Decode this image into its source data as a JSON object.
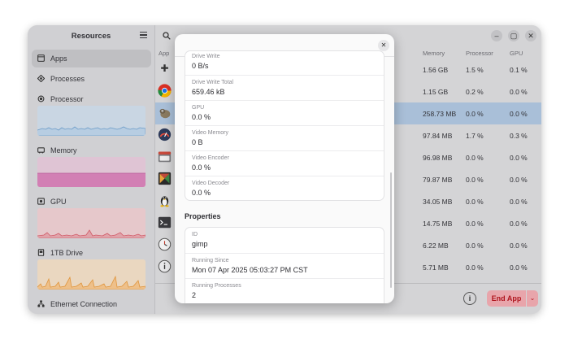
{
  "sidebar": {
    "title": "Resources",
    "items": [
      {
        "label": "Apps",
        "icon": "apps-icon"
      },
      {
        "label": "Processes",
        "icon": "processes-icon"
      },
      {
        "label": "Processor",
        "icon": "processor-icon"
      },
      {
        "label": "Memory",
        "icon": "memory-icon"
      },
      {
        "label": "GPU",
        "icon": "gpu-icon"
      },
      {
        "label": "1TB Drive",
        "icon": "drive-icon"
      },
      {
        "label": "Ethernet Connection",
        "icon": "network-icon"
      }
    ]
  },
  "table": {
    "columns": {
      "app": "App",
      "memory": "Memory",
      "processor": "Processor",
      "gpu": "GPU"
    },
    "rows": [
      {
        "icon": "puzzle-icon",
        "memory": "1.56 GB",
        "processor": "1.5 %",
        "gpu": "0.1 %"
      },
      {
        "icon": "chrome-icon",
        "memory": "1.15 GB",
        "processor": "0.2 %",
        "gpu": "0.0 %"
      },
      {
        "icon": "gimp-icon",
        "memory": "258.73 MB",
        "processor": "0.0 %",
        "gpu": "0.0 %"
      },
      {
        "icon": "gauge-icon",
        "memory": "97.84 MB",
        "processor": "1.7 %",
        "gpu": "0.3 %"
      },
      {
        "icon": "files-icon",
        "memory": "96.98 MB",
        "processor": "0.0 %",
        "gpu": "0.0 %"
      },
      {
        "icon": "colorful-app-icon",
        "memory": "79.87 MB",
        "processor": "0.0 %",
        "gpu": "0.0 %"
      },
      {
        "icon": "tux-icon",
        "memory": "34.05 MB",
        "processor": "0.0 %",
        "gpu": "0.0 %"
      },
      {
        "icon": "terminal-icon",
        "memory": "14.75 MB",
        "processor": "0.0 %",
        "gpu": "0.0 %"
      },
      {
        "icon": "clock-icon",
        "memory": "6.22 MB",
        "processor": "0.0 %",
        "gpu": "0.0 %"
      },
      {
        "icon": "info-app-icon",
        "memory": "5.71 MB",
        "processor": "0.0 %",
        "gpu": "0.0 %"
      }
    ]
  },
  "footer": {
    "info_label": "i",
    "end_app_label": "End App"
  },
  "dialog": {
    "stats": [
      {
        "key": "Drive Write",
        "value": "0 B/s"
      },
      {
        "key": "Drive Write Total",
        "value": "659.46 kB"
      },
      {
        "key": "GPU",
        "value": "0.0 %"
      },
      {
        "key": "Video Memory",
        "value": "0 B"
      },
      {
        "key": "Video Encoder",
        "value": "0.0 %"
      },
      {
        "key": "Video Decoder",
        "value": "0.0 %"
      }
    ],
    "properties_title": "Properties",
    "properties": [
      {
        "key": "ID",
        "value": "gimp"
      },
      {
        "key": "Running Since",
        "value": "Mon 07 Apr 2025 05:03:27 PM CST"
      },
      {
        "key": "Running Processes",
        "value": "2"
      }
    ]
  },
  "colors": {
    "accent_selected": "#a9bfd8",
    "danger": "#b0161f",
    "danger_bg": "#e8a5ab"
  }
}
